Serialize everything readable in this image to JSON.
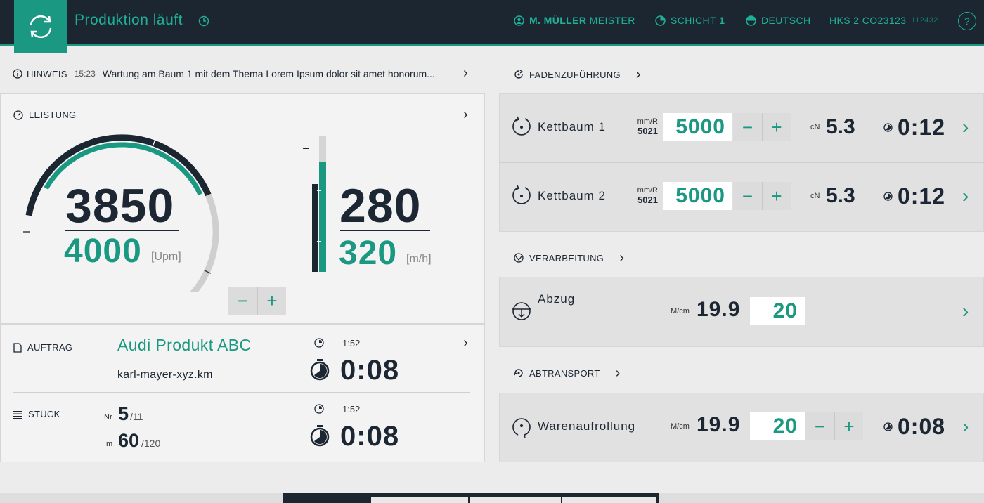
{
  "header": {
    "status": "Produktion läuft",
    "user_name": "M. MÜLLER",
    "user_role": "MEISTER",
    "shift_label": "SCHICHT",
    "shift_number": "1",
    "language": "DEUTSCH",
    "machine": "HKS 2 CO23123",
    "machine_serial": "112432",
    "help": "?",
    "icons": [
      "sync-icon",
      "clock-icon",
      "user-icon",
      "shift-icon",
      "language-icon",
      "help-icon"
    ]
  },
  "hint": {
    "label": "HINWEIS",
    "time": "15:23",
    "text": "Wartung am  Baum 1 mit dem Thema Lorem Ipsum dolor sit amet honorum..."
  },
  "leistung": {
    "label": "LEISTUNG",
    "speed_actual": "3850",
    "speed_target": "4000",
    "speed_unit": "[Upm]",
    "speed_fraction": 0.96,
    "speed_bar_fraction": 0.75,
    "rate_actual": "280",
    "rate_target": "320",
    "rate_unit": "[m/h]",
    "rate_fraction": 0.81,
    "minus": "−",
    "plus": "+"
  },
  "auftrag": {
    "label": "AUFTRAG",
    "product": "Audi Produkt ABC",
    "file": "karl-mayer-xyz.km",
    "time_small": "1:52",
    "time_big": "0:08"
  },
  "stueck": {
    "label": "STÜCK",
    "nr_label": "Nr",
    "nr_value": "5",
    "nr_total": "/11",
    "m_label": "m",
    "m_value": "60",
    "m_total": "/120",
    "time_small": "1:52",
    "time_big": "0:08"
  },
  "fadenzufuehrung": {
    "label": "FADENZUFÜHRUNG",
    "rows": [
      {
        "name": "Kettbaum 1",
        "unit": "mm/R",
        "unit_value": "5021",
        "value": "5000",
        "cn_label": "cN",
        "cn_value": "5.3",
        "time": "0:12"
      },
      {
        "name": "Kettbaum 2",
        "unit": "mm/R",
        "unit_value": "5021",
        "value": "5000",
        "cn_label": "cN",
        "cn_value": "5.3",
        "time": "0:12"
      }
    ]
  },
  "verarbeitung": {
    "label": "VERARBEITUNG",
    "name": "Abzug",
    "unit": "M/cm",
    "actual": "19.9",
    "value": "20"
  },
  "abtransport": {
    "label": "ABTRANSPORT",
    "name": "Warenaufrollung",
    "unit": "M/cm",
    "actual": "19.9",
    "value": "20",
    "time": "0:08"
  },
  "colors": {
    "accent": "#1a9882",
    "dark": "#1b2631"
  }
}
